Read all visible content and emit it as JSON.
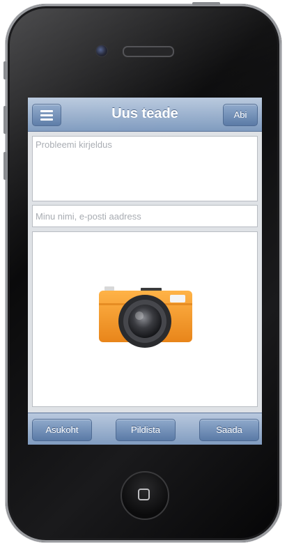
{
  "navbar": {
    "title": "Uus teade",
    "menu_icon": "hamburger-menu-icon",
    "help_label": "Abi"
  },
  "form": {
    "description_placeholder": "Probleemi kirjeldus",
    "name_email_placeholder": "Minu nimi, e-posti aadress"
  },
  "photo": {
    "icon": "camera-icon"
  },
  "toolbar": {
    "location_label": "Asukoht",
    "photo_label": "Pildista",
    "send_label": "Saada"
  },
  "colors": {
    "bar_gradient_top": "#b9c9de",
    "bar_gradient_bottom": "#7f9bbf",
    "button": "#5a7aa6",
    "camera_body": "#f39c26"
  }
}
